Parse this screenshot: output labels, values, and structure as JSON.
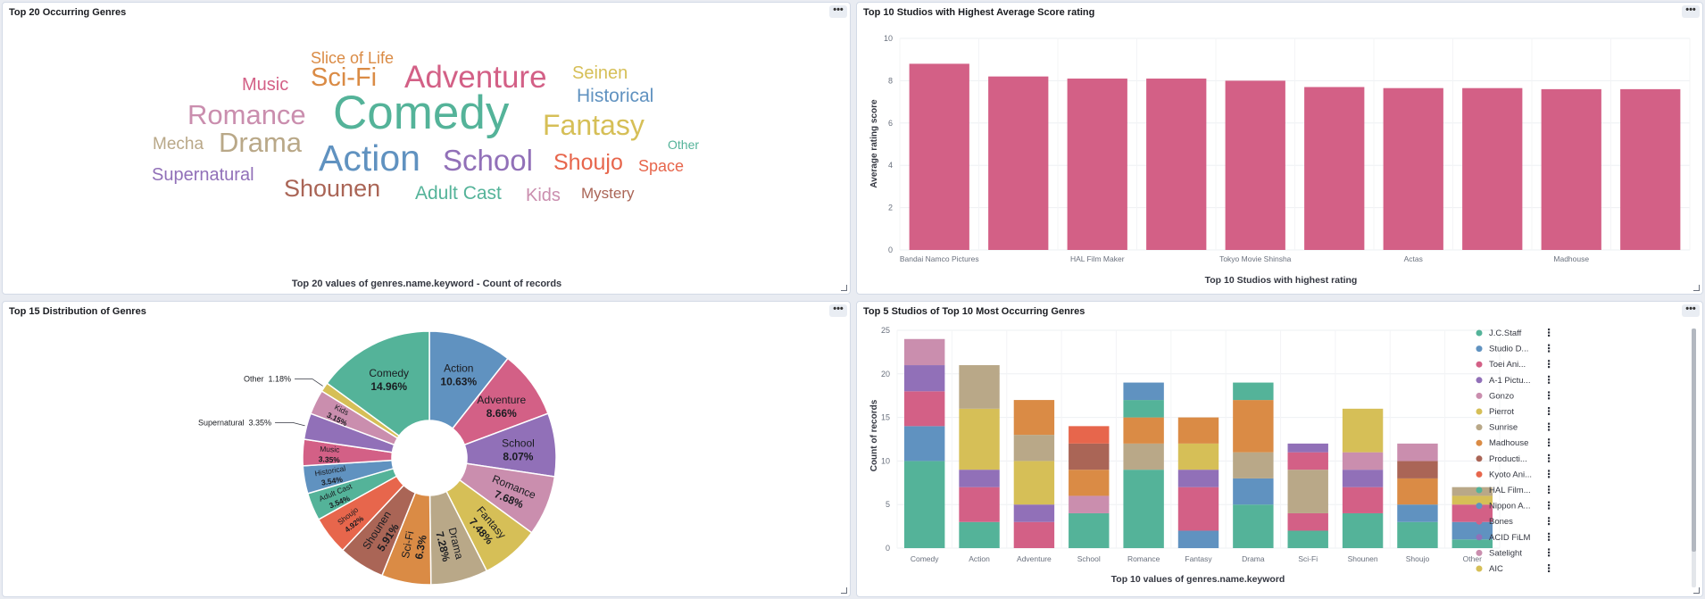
{
  "panels": {
    "p1": {
      "title": "Top 20 Occurring Genres"
    },
    "p2": {
      "title": "Top 10 Studios with Highest Average Score rating"
    },
    "p3": {
      "title": "Top 15 Distribution of Genres"
    },
    "p4": {
      "title": "Top 5 Studios of Top 10 Most Occurring Genres"
    }
  },
  "panel_menu_label": "•••",
  "chart_data": [
    {
      "type": "wordcloud",
      "title": "Top 20 Occurring Genres",
      "caption": "Top 20 values of genres.name.keyword - Count of records",
      "words": [
        {
          "text": "Slice of Life",
          "color": "#da8b45"
        },
        {
          "text": "Sci-Fi",
          "color": "#da8b45"
        },
        {
          "text": "Adventure",
          "color": "#d36086"
        },
        {
          "text": "Seinen",
          "color": "#d6bf57"
        },
        {
          "text": "Music",
          "color": "#d36086"
        },
        {
          "text": "Historical",
          "color": "#6092c0"
        },
        {
          "text": "Romance",
          "color": "#ca8eae"
        },
        {
          "text": "Comedy",
          "color": "#54b399"
        },
        {
          "text": "Fantasy",
          "color": "#d6bf57"
        },
        {
          "text": "Other",
          "color": "#54b399"
        },
        {
          "text": "Mecha",
          "color": "#b9a888"
        },
        {
          "text": "Drama",
          "color": "#b9a888"
        },
        {
          "text": "Action",
          "color": "#6092c0"
        },
        {
          "text": "School",
          "color": "#9170b8"
        },
        {
          "text": "Shoujo",
          "color": "#e7664c"
        },
        {
          "text": "Space",
          "color": "#e7664c"
        },
        {
          "text": "Supernatural",
          "color": "#9170b8"
        },
        {
          "text": "Shounen",
          "color": "#aa6556"
        },
        {
          "text": "Adult Cast",
          "color": "#54b399"
        },
        {
          "text": "Kids",
          "color": "#ca8eae"
        },
        {
          "text": "Mystery",
          "color": "#aa6556"
        }
      ]
    },
    {
      "type": "bar",
      "title": "Top 10 Studios with Highest Average Score rating",
      "xlabel": "Top 10 Studios with highest rating",
      "ylabel": "Average rating score",
      "ylim": [
        0,
        10
      ],
      "yticks": [
        0,
        2,
        4,
        6,
        8,
        10
      ],
      "categories": [
        "Bandai Namco Pictures",
        "",
        "HAL Film Maker",
        "",
        "Tokyo Movie Shinsha",
        "",
        "Actas",
        "",
        "Madhouse",
        ""
      ],
      "values": [
        8.8,
        8.2,
        8.1,
        8.1,
        8.0,
        7.7,
        7.65,
        7.65,
        7.6,
        7.6
      ],
      "color": "#d36086",
      "grid": true
    },
    {
      "type": "pie",
      "donut": true,
      "title": "Top 15 Distribution of Genres",
      "slices": [
        {
          "label": "Action",
          "value": 10.63,
          "pct": "10.63%",
          "color": "#6092c0",
          "inside": true
        },
        {
          "label": "Adventure",
          "value": 8.66,
          "pct": "8.66%",
          "color": "#d36086",
          "inside": true
        },
        {
          "label": "School",
          "value": 8.07,
          "pct": "8.07%",
          "color": "#9170b8",
          "inside": true
        },
        {
          "label": "Romance",
          "value": 7.68,
          "pct": "7.68%",
          "color": "#ca8eae",
          "inside": true
        },
        {
          "label": "Fantasy",
          "value": 7.48,
          "pct": "7.48%",
          "color": "#d6bf57",
          "inside": true
        },
        {
          "label": "Drama",
          "value": 7.28,
          "pct": "7.28%",
          "color": "#b9a888",
          "inside": true
        },
        {
          "label": "Sci-Fi",
          "value": 6.3,
          "pct": "6.3%",
          "color": "#da8b45",
          "inside": true
        },
        {
          "label": "Shounen",
          "value": 5.91,
          "pct": "5.91%",
          "color": "#aa6556",
          "inside": true
        },
        {
          "label": "Shoujo",
          "value": 4.92,
          "pct": "4.92%",
          "color": "#e7664c",
          "inside": true
        },
        {
          "label": "Adult Cast",
          "value": 3.54,
          "pct": "3.54%",
          "color": "#54b399",
          "inside": true
        },
        {
          "label": "Historical",
          "value": 3.54,
          "pct": "3.54%",
          "color": "#6092c0",
          "inside": true
        },
        {
          "label": "Music",
          "value": 3.35,
          "pct": "3.35%",
          "color": "#d36086",
          "inside": true
        },
        {
          "label": "Supernatural",
          "value": 3.35,
          "pct": "3.35%",
          "color": "#9170b8",
          "inside": false
        },
        {
          "label": "Kids",
          "value": 3.15,
          "pct": "3.15%",
          "color": "#ca8eae",
          "inside": true
        },
        {
          "label": "Other",
          "value": 1.18,
          "pct": "1.18%",
          "color": "#d6bf57",
          "inside": false
        },
        {
          "label": "Comedy",
          "value": 14.96,
          "pct": "14.96%",
          "color": "#54b399",
          "inside": true
        }
      ]
    },
    {
      "type": "bar",
      "stacked": true,
      "title": "Top 5 Studios of Top 10 Most Occurring Genres",
      "xlabel": "Top 10 values of genres.name.keyword",
      "ylabel": "Count of records",
      "ylim": [
        0,
        25
      ],
      "yticks": [
        0,
        5,
        10,
        15,
        20,
        25
      ],
      "categories": [
        "Comedy",
        "Action",
        "Adventure",
        "School",
        "Romance",
        "Fantasy",
        "Drama",
        "Sci-Fi",
        "Shounen",
        "Shoujo",
        "Other"
      ],
      "legend_position": "right",
      "legend": [
        {
          "name": "J.C.Staff",
          "color": "#54b399"
        },
        {
          "name": "Studio D...",
          "color": "#6092c0"
        },
        {
          "name": "Toei Ani...",
          "color": "#d36086"
        },
        {
          "name": "A-1 Pictu...",
          "color": "#9170b8"
        },
        {
          "name": "Gonzo",
          "color": "#ca8eae"
        },
        {
          "name": "Pierrot",
          "color": "#d6bf57"
        },
        {
          "name": "Sunrise",
          "color": "#b9a888"
        },
        {
          "name": "Madhouse",
          "color": "#da8b45"
        },
        {
          "name": "Producti...",
          "color": "#aa6556"
        },
        {
          "name": "Kyoto Ani...",
          "color": "#e7664c"
        },
        {
          "name": "HAL Film...",
          "color": "#54b399"
        },
        {
          "name": "Nippon A...",
          "color": "#6092c0"
        },
        {
          "name": "Bones",
          "color": "#d36086"
        },
        {
          "name": "ACID FiLM",
          "color": "#9170b8"
        },
        {
          "name": "Satelight",
          "color": "#ca8eae"
        },
        {
          "name": "AIC",
          "color": "#d6bf57"
        }
      ],
      "stacks": [
        [
          {
            "c": "#54b399",
            "v": 10
          },
          {
            "c": "#6092c0",
            "v": 4
          },
          {
            "c": "#d36086",
            "v": 4
          },
          {
            "c": "#9170b8",
            "v": 3
          },
          {
            "c": "#ca8eae",
            "v": 3
          }
        ],
        [
          {
            "c": "#54b399",
            "v": 3
          },
          {
            "c": "#d36086",
            "v": 4
          },
          {
            "c": "#9170b8",
            "v": 2
          },
          {
            "c": "#d6bf57",
            "v": 7
          },
          {
            "c": "#b9a888",
            "v": 5
          }
        ],
        [
          {
            "c": "#d36086",
            "v": 3
          },
          {
            "c": "#9170b8",
            "v": 2
          },
          {
            "c": "#d6bf57",
            "v": 5
          },
          {
            "c": "#b9a888",
            "v": 3
          },
          {
            "c": "#da8b45",
            "v": 4
          }
        ],
        [
          {
            "c": "#54b399",
            "v": 4
          },
          {
            "c": "#ca8eae",
            "v": 2
          },
          {
            "c": "#da8b45",
            "v": 3
          },
          {
            "c": "#aa6556",
            "v": 3
          },
          {
            "c": "#e7664c",
            "v": 2
          }
        ],
        [
          {
            "c": "#54b399",
            "v": 9
          },
          {
            "c": "#b9a888",
            "v": 3
          },
          {
            "c": "#da8b45",
            "v": 3
          },
          {
            "c": "#54b399",
            "v": 2
          },
          {
            "c": "#6092c0",
            "v": 2
          }
        ],
        [
          {
            "c": "#6092c0",
            "v": 2
          },
          {
            "c": "#d36086",
            "v": 5
          },
          {
            "c": "#9170b8",
            "v": 2
          },
          {
            "c": "#d6bf57",
            "v": 3
          },
          {
            "c": "#da8b45",
            "v": 3
          }
        ],
        [
          {
            "c": "#54b399",
            "v": 5
          },
          {
            "c": "#6092c0",
            "v": 3
          },
          {
            "c": "#b9a888",
            "v": 3
          },
          {
            "c": "#da8b45",
            "v": 6
          },
          {
            "c": "#54b399",
            "v": 2
          }
        ],
        [
          {
            "c": "#54b399",
            "v": 2
          },
          {
            "c": "#d36086",
            "v": 2
          },
          {
            "c": "#b9a888",
            "v": 5
          },
          {
            "c": "#d36086",
            "v": 2
          },
          {
            "c": "#9170b8",
            "v": 1
          }
        ],
        [
          {
            "c": "#54b399",
            "v": 4
          },
          {
            "c": "#d36086",
            "v": 3
          },
          {
            "c": "#9170b8",
            "v": 2
          },
          {
            "c": "#ca8eae",
            "v": 2
          },
          {
            "c": "#d6bf57",
            "v": 5
          }
        ],
        [
          {
            "c": "#54b399",
            "v": 3
          },
          {
            "c": "#6092c0",
            "v": 2
          },
          {
            "c": "#da8b45",
            "v": 3
          },
          {
            "c": "#aa6556",
            "v": 2
          },
          {
            "c": "#ca8eae",
            "v": 2
          }
        ],
        [
          {
            "c": "#54b399",
            "v": 1
          },
          {
            "c": "#6092c0",
            "v": 2
          },
          {
            "c": "#d36086",
            "v": 2
          },
          {
            "c": "#d6bf57",
            "v": 1
          },
          {
            "c": "#b9a888",
            "v": 1
          }
        ]
      ]
    }
  ]
}
